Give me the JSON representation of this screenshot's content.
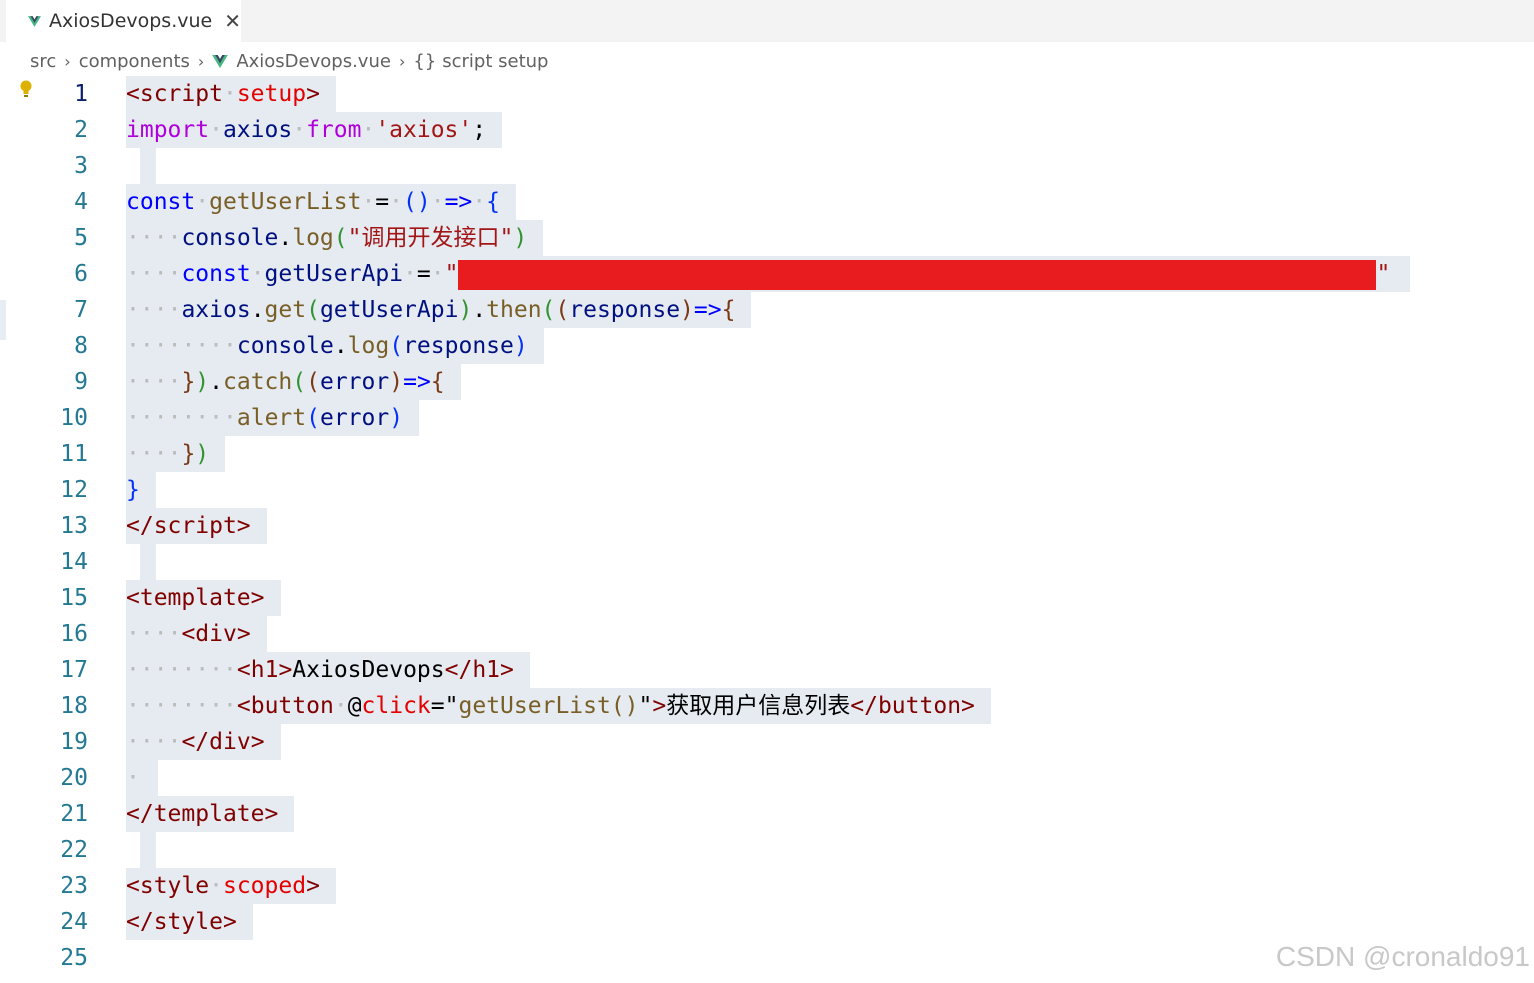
{
  "tab": {
    "filename": "AxiosDevops.vue",
    "close_glyph": "✕",
    "icon": "vue-logo-icon"
  },
  "breadcrumb": {
    "src": "src",
    "components": "components",
    "file": "AxiosDevops.vue",
    "braces": "{}",
    "symbol": "script setup",
    "sep": "›"
  },
  "editor": {
    "active_line": 1,
    "line_numbers": [
      "1",
      "2",
      "3",
      "4",
      "5",
      "6",
      "7",
      "8",
      "9",
      "10",
      "11",
      "12",
      "13",
      "14",
      "15",
      "16",
      "17",
      "18",
      "19",
      "20",
      "21",
      "22",
      "23",
      "24",
      "25"
    ],
    "tokens": {
      "lt": "<",
      "gt": ">",
      "lts": "</",
      "dot": "·",
      "script": "script",
      "setup": "setup",
      "import": "import",
      "axios": "axios",
      "from": "from",
      "axios_str": "'axios'",
      "semi": ";",
      "const": "const",
      "getUserList": "getUserList",
      "eq": "=",
      "parens": "()",
      "arrow": "=>",
      "lbrace": "{",
      "rbrace": "}",
      "console": "console",
      "log": "log",
      "lparen": "(",
      "rparen": ")",
      "log_str": "\"调用开发接口\"",
      "getUserApi": "getUserApi",
      "quote": "\"",
      "get": "get",
      "then": "then",
      "response": "response",
      "arrow2": "=>",
      "catch": "catch",
      "error": "error",
      "alert": "alert",
      "template": "template",
      "div": "div",
      "h1": "h1",
      "h1_text": "AxiosDevops",
      "button": "button",
      "at": "@",
      "click": "click",
      "click_val": "getUserList()",
      "button_text": "获取用户信息列表",
      "style": "style",
      "scoped": "scoped"
    }
  },
  "watermark": "CSDN @cronaldo91",
  "colors": {
    "tag": "#800000",
    "attr": "#e50000",
    "keyword": "#0000ff",
    "control": "#af00db",
    "string": "#a31515",
    "variable": "#001080",
    "function": "#795e26",
    "redaction": "#e81c1f",
    "line_number": "#237893"
  }
}
